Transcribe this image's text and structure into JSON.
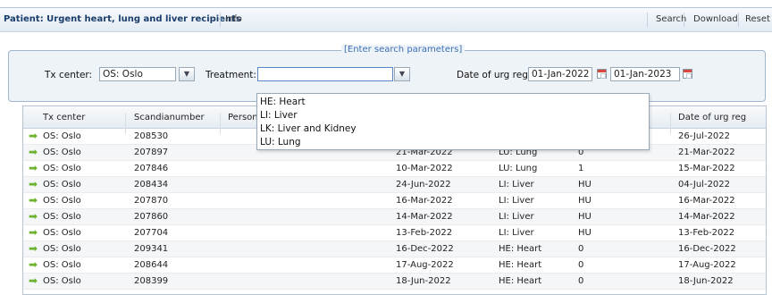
{
  "toolbar": {
    "title": "Patient: Urgent heart, lung and liver recipients",
    "info_label": "Info",
    "search_label": "Search",
    "download_label": "Download",
    "reset_label": "Reset"
  },
  "search": {
    "legend": "[Enter search parameters]",
    "tx_center_label": "Tx center:",
    "tx_center_value": "OS: Oslo",
    "treatment_label": "Treatment:",
    "treatment_value": "",
    "date_label": "Date of urg reg:",
    "date_from": "01-Jan-2022",
    "date_to": "01-Jan-2023"
  },
  "treatment_options": [
    "HE: Heart",
    "LI: Liver",
    "LK: Liver and Kidney",
    "LU: Lung"
  ],
  "grid": {
    "headers": [
      "Tx center",
      "Scandianumber",
      "Person i",
      "Date of urg reg"
    ],
    "rows": [
      {
        "center": "OS: Oslo",
        "scandia": "208530",
        "date1": "",
        "treatment": "",
        "status": "",
        "date2": "26-Jul-2022"
      },
      {
        "center": "OS: Oslo",
        "scandia": "207897",
        "date1": "21-Mar-2022",
        "treatment": "LU: Lung",
        "status": "0",
        "date2": "21-Mar-2022"
      },
      {
        "center": "OS: Oslo",
        "scandia": "207846",
        "date1": "10-Mar-2022",
        "treatment": "LU: Lung",
        "status": "1",
        "date2": "15-Mar-2022"
      },
      {
        "center": "OS: Oslo",
        "scandia": "208434",
        "date1": "24-Jun-2022",
        "treatment": "LI: Liver",
        "status": "HU",
        "date2": "04-Jul-2022"
      },
      {
        "center": "OS: Oslo",
        "scandia": "207870",
        "date1": "16-Mar-2022",
        "treatment": "LI: Liver",
        "status": "HU",
        "date2": "16-Mar-2022"
      },
      {
        "center": "OS: Oslo",
        "scandia": "207860",
        "date1": "14-Mar-2022",
        "treatment": "LI: Liver",
        "status": "HU",
        "date2": "14-Mar-2022"
      },
      {
        "center": "OS: Oslo",
        "scandia": "207704",
        "date1": "13-Feb-2022",
        "treatment": "LI: Liver",
        "status": "HU",
        "date2": "13-Feb-2022"
      },
      {
        "center": "OS: Oslo",
        "scandia": "209341",
        "date1": "16-Dec-2022",
        "treatment": "HE: Heart",
        "status": "0",
        "date2": "16-Dec-2022"
      },
      {
        "center": "OS: Oslo",
        "scandia": "208644",
        "date1": "17-Aug-2022",
        "treatment": "HE: Heart",
        "status": "0",
        "date2": "17-Aug-2022"
      },
      {
        "center": "OS: Oslo",
        "scandia": "208399",
        "date1": "18-Jun-2022",
        "treatment": "HE: Heart",
        "status": "0",
        "date2": "18-Jun-2022"
      }
    ]
  },
  "icons": {
    "row_arrow": "arrow-right-icon",
    "dropdown": "chevron-down-icon",
    "calendar": "calendar-icon"
  },
  "colors": {
    "title": "#1a3d6b",
    "legend": "#3b6fb5",
    "row_arrow": "#6cb22d",
    "calendar_accent": "#d8473a"
  }
}
